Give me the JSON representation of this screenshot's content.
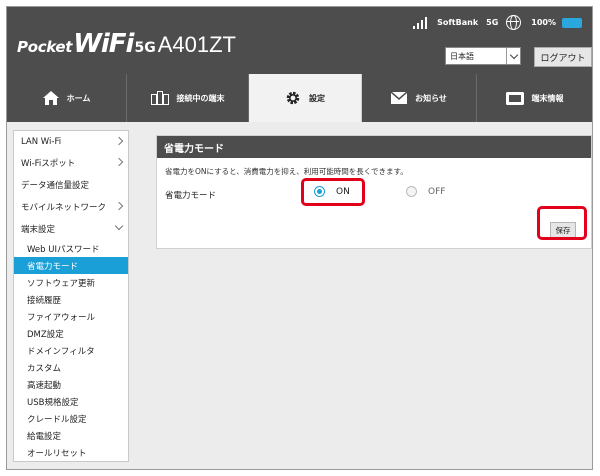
{
  "header": {
    "logo_pocket": "Pocket",
    "logo_wifi": "WiFi",
    "logo_5g": "5G",
    "model": "A401ZT",
    "carrier": "SoftBank",
    "network": "5G",
    "battery_percent": "100%",
    "language_selected": "日本語",
    "logout_label": "ログアウト"
  },
  "tabs": [
    {
      "label": "ホーム",
      "icon": "home-icon"
    },
    {
      "label": "接続中の端末",
      "icon": "devices-icon"
    },
    {
      "label": "設定",
      "icon": "gear-icon",
      "active": true
    },
    {
      "label": "お知らせ",
      "icon": "envelope-icon"
    },
    {
      "label": "端末情報",
      "icon": "device-info-icon"
    }
  ],
  "sidebar": {
    "items": [
      {
        "label": "LAN Wi-Fi"
      },
      {
        "label": "Wi-Fiスポット"
      },
      {
        "label": "データ通信量設定"
      },
      {
        "label": "モバイルネットワーク"
      },
      {
        "label": "端末設定"
      }
    ],
    "sub_items": [
      {
        "label": "Web UIパスワード"
      },
      {
        "label": "省電力モード",
        "selected": true
      },
      {
        "label": "ソフトウェア更新"
      },
      {
        "label": "接続履歴"
      },
      {
        "label": "ファイアウォール"
      },
      {
        "label": "DMZ設定"
      },
      {
        "label": "ドメインフィルタ"
      },
      {
        "label": "カスタム"
      },
      {
        "label": "高速起動"
      },
      {
        "label": "USB規格設定"
      },
      {
        "label": "クレードル設定"
      },
      {
        "label": "給電設定"
      },
      {
        "label": "オールリセット"
      }
    ]
  },
  "panel": {
    "title": "省電力モード",
    "description": "省電力をONにすると、消費電力を抑え、利用可能時間を長くできます。",
    "row_label": "省電力モード",
    "on_label": "ON",
    "off_label": "OFF",
    "selected": "ON",
    "save_label": "保存"
  },
  "colors": {
    "header_bg": "#4d4d4d",
    "accent": "#1a9fd7",
    "highlight": "#e3001b"
  }
}
